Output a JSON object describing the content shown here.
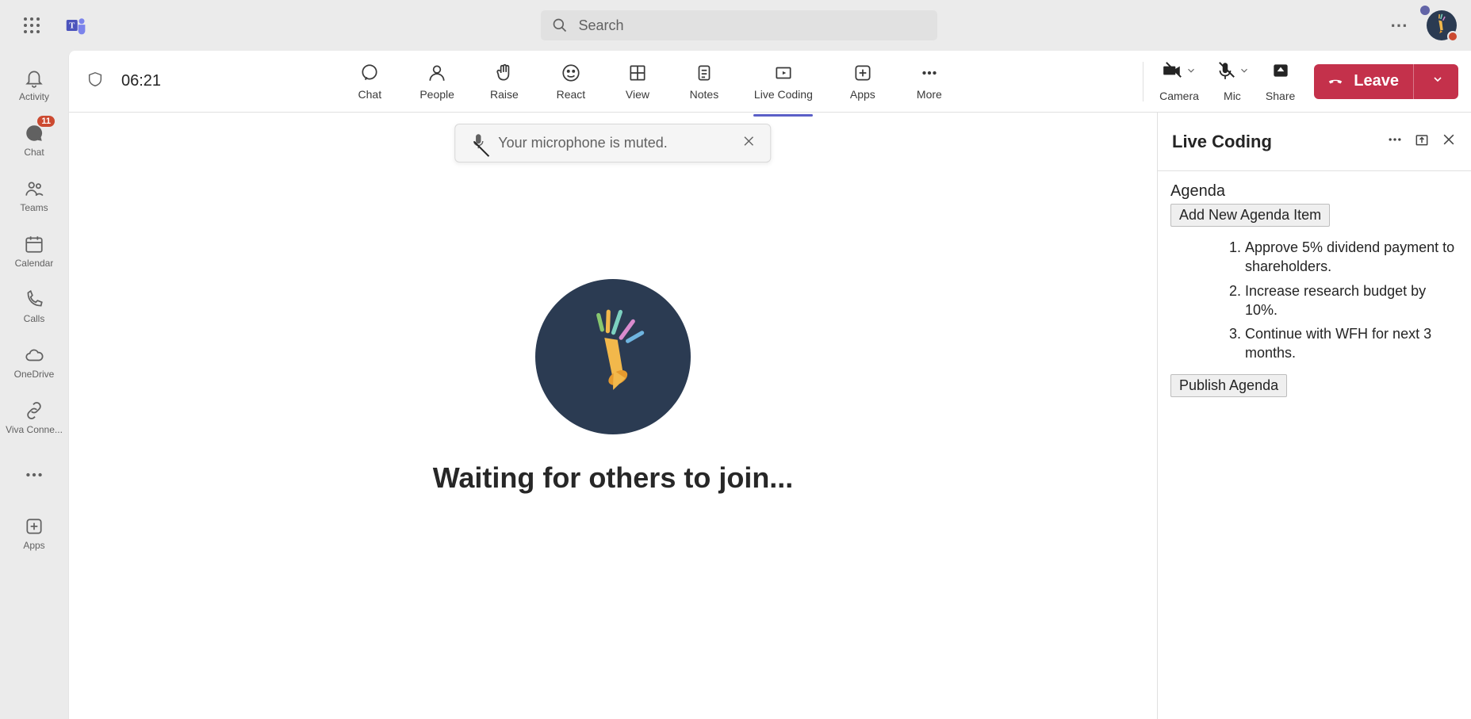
{
  "search": {
    "placeholder": "Search"
  },
  "rail": {
    "activity": "Activity",
    "chat": "Chat",
    "chat_badge": "11",
    "teams": "Teams",
    "calendar": "Calendar",
    "calls": "Calls",
    "onedrive": "OneDrive",
    "viva": "Viva Conne...",
    "apps": "Apps"
  },
  "meeting": {
    "timer": "06:21",
    "toolbar": {
      "chat": "Chat",
      "people": "People",
      "raise": "Raise",
      "react": "React",
      "view": "View",
      "notes": "Notes",
      "livecoding": "Live Coding",
      "apps": "Apps",
      "more": "More"
    },
    "controls": {
      "camera": "Camera",
      "mic": "Mic",
      "share": "Share",
      "leave": "Leave"
    },
    "toast": "Your microphone is muted.",
    "waiting": "Waiting for others to join..."
  },
  "panel": {
    "title": "Live Coding",
    "agenda_label": "Agenda",
    "add_button": "Add New Agenda Item",
    "items": [
      "Approve 5% dividend payment to shareholders.",
      "Increase research budget by 10%.",
      "Continue with WFH for next 3 months."
    ],
    "publish_button": "Publish Agenda"
  }
}
